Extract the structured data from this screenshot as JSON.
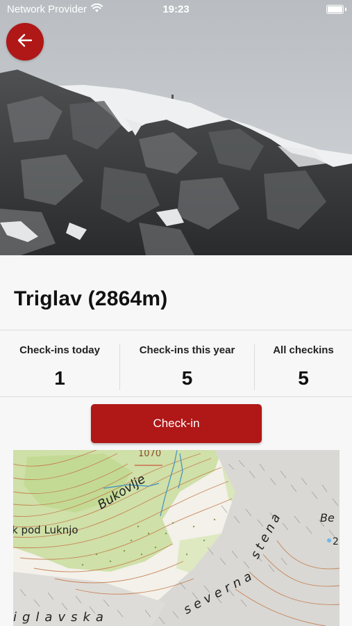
{
  "status_bar": {
    "carrier": "Network Provider",
    "time": "19:23"
  },
  "hero": {
    "description_icon": "mountain-photo"
  },
  "back_button": {
    "icon": "arrow-left-icon"
  },
  "peak": {
    "title": "Triglav (2864m)"
  },
  "stats": [
    {
      "label": "Check-ins today",
      "value": "1"
    },
    {
      "label": "Check-ins this year",
      "value": "5"
    },
    {
      "label": "All checkins",
      "value": "5"
    }
  ],
  "checkin_button": {
    "label": "Check-in"
  },
  "map": {
    "labels": {
      "bukovlje": "Bukovlje",
      "pod_luknjo": "k pod Luknjo",
      "severna_stena": "severna",
      "stena": "stena",
      "triglavska": "iglavska",
      "elev": "1070",
      "be": "Be",
      "two": "2"
    }
  },
  "colors": {
    "accent": "#b01717",
    "text": "#111111"
  }
}
